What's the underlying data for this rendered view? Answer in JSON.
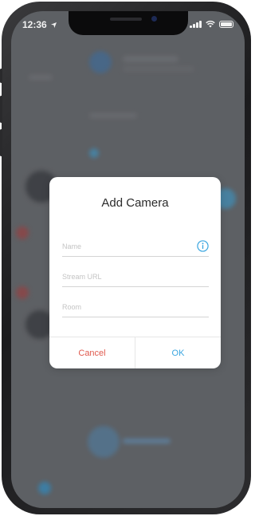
{
  "status_bar": {
    "time": "12:36"
  },
  "dialog": {
    "title": "Add Camera",
    "fields": [
      {
        "placeholder": "Name",
        "value": "",
        "has_info_icon": true
      },
      {
        "placeholder": "Stream URL",
        "value": ""
      },
      {
        "placeholder": "Room",
        "value": ""
      }
    ],
    "cancel_label": "Cancel",
    "ok_label": "OK"
  },
  "colors": {
    "accent": "#3aa6e0",
    "cancel": "#e05a4e"
  },
  "icons": [
    "location-arrow-icon",
    "signal-icon",
    "wifi-icon",
    "battery-icon",
    "info-icon"
  ]
}
